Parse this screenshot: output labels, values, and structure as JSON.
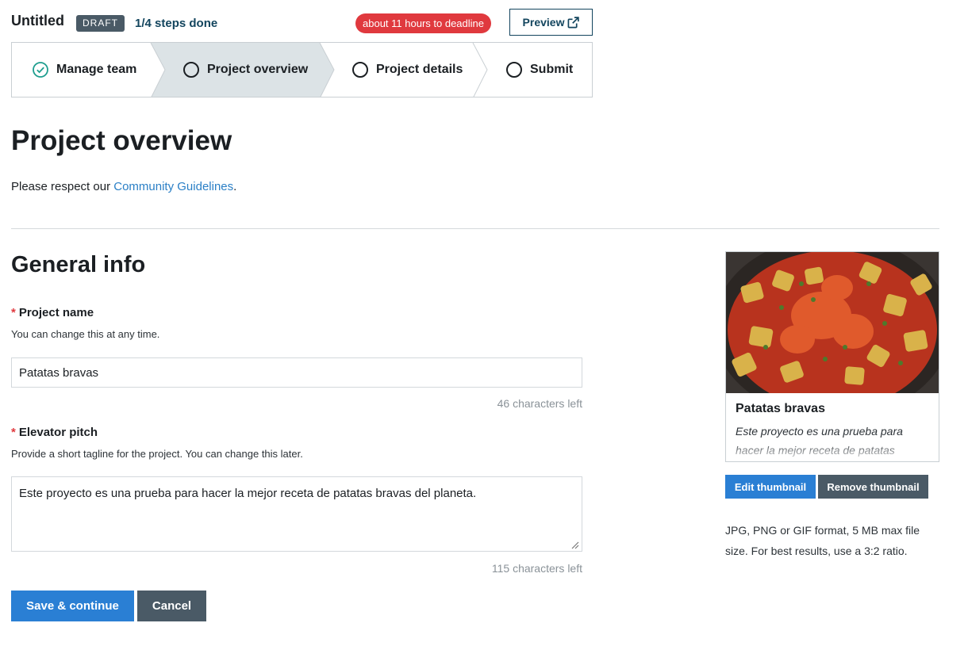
{
  "header": {
    "title": "Untitled",
    "status_badge": "DRAFT",
    "progress_text": "1/4 steps done",
    "deadline_text": "about 11 hours to deadline",
    "preview_label": "Preview"
  },
  "stepper": {
    "steps": [
      {
        "label": "Manage team",
        "state": "completed"
      },
      {
        "label": "Project overview",
        "state": "active"
      },
      {
        "label": "Project details",
        "state": "pending"
      },
      {
        "label": "Submit",
        "state": "pending"
      }
    ]
  },
  "page": {
    "title": "Project overview",
    "guidelines_prefix": "Please respect our ",
    "guidelines_link": "Community Guidelines",
    "guidelines_suffix": "."
  },
  "general_info": {
    "title": "General info",
    "project_name": {
      "label": "Project name",
      "help": "You can change this at any time.",
      "value": "Patatas bravas",
      "chars_left": "46 characters left"
    },
    "elevator_pitch": {
      "label": "Elevator pitch",
      "help": "Provide a short tagline for the project. You can change this later.",
      "value": "Este proyecto es una prueba para hacer la mejor receta de patatas bravas del planeta.",
      "chars_left": "115 characters left"
    },
    "save_label": "Save & continue",
    "cancel_label": "Cancel"
  },
  "thumbnail": {
    "card_title": "Patatas bravas",
    "card_description": "Este proyecto es una prueba para hacer la mejor receta de patatas bravas del planeta.",
    "edit_label": "Edit thumbnail",
    "remove_label": "Remove thumbnail",
    "help_text": "JPG, PNG or GIF format, 5 MB max file size. For best results, use a 3:2 ratio."
  },
  "colors": {
    "accent_blue": "#2a7fd4",
    "dark_slate": "#4a5a66",
    "deadline_red": "#e0393e",
    "active_step_bg": "#dce3e6",
    "completed_check": "#1f9e8f"
  }
}
